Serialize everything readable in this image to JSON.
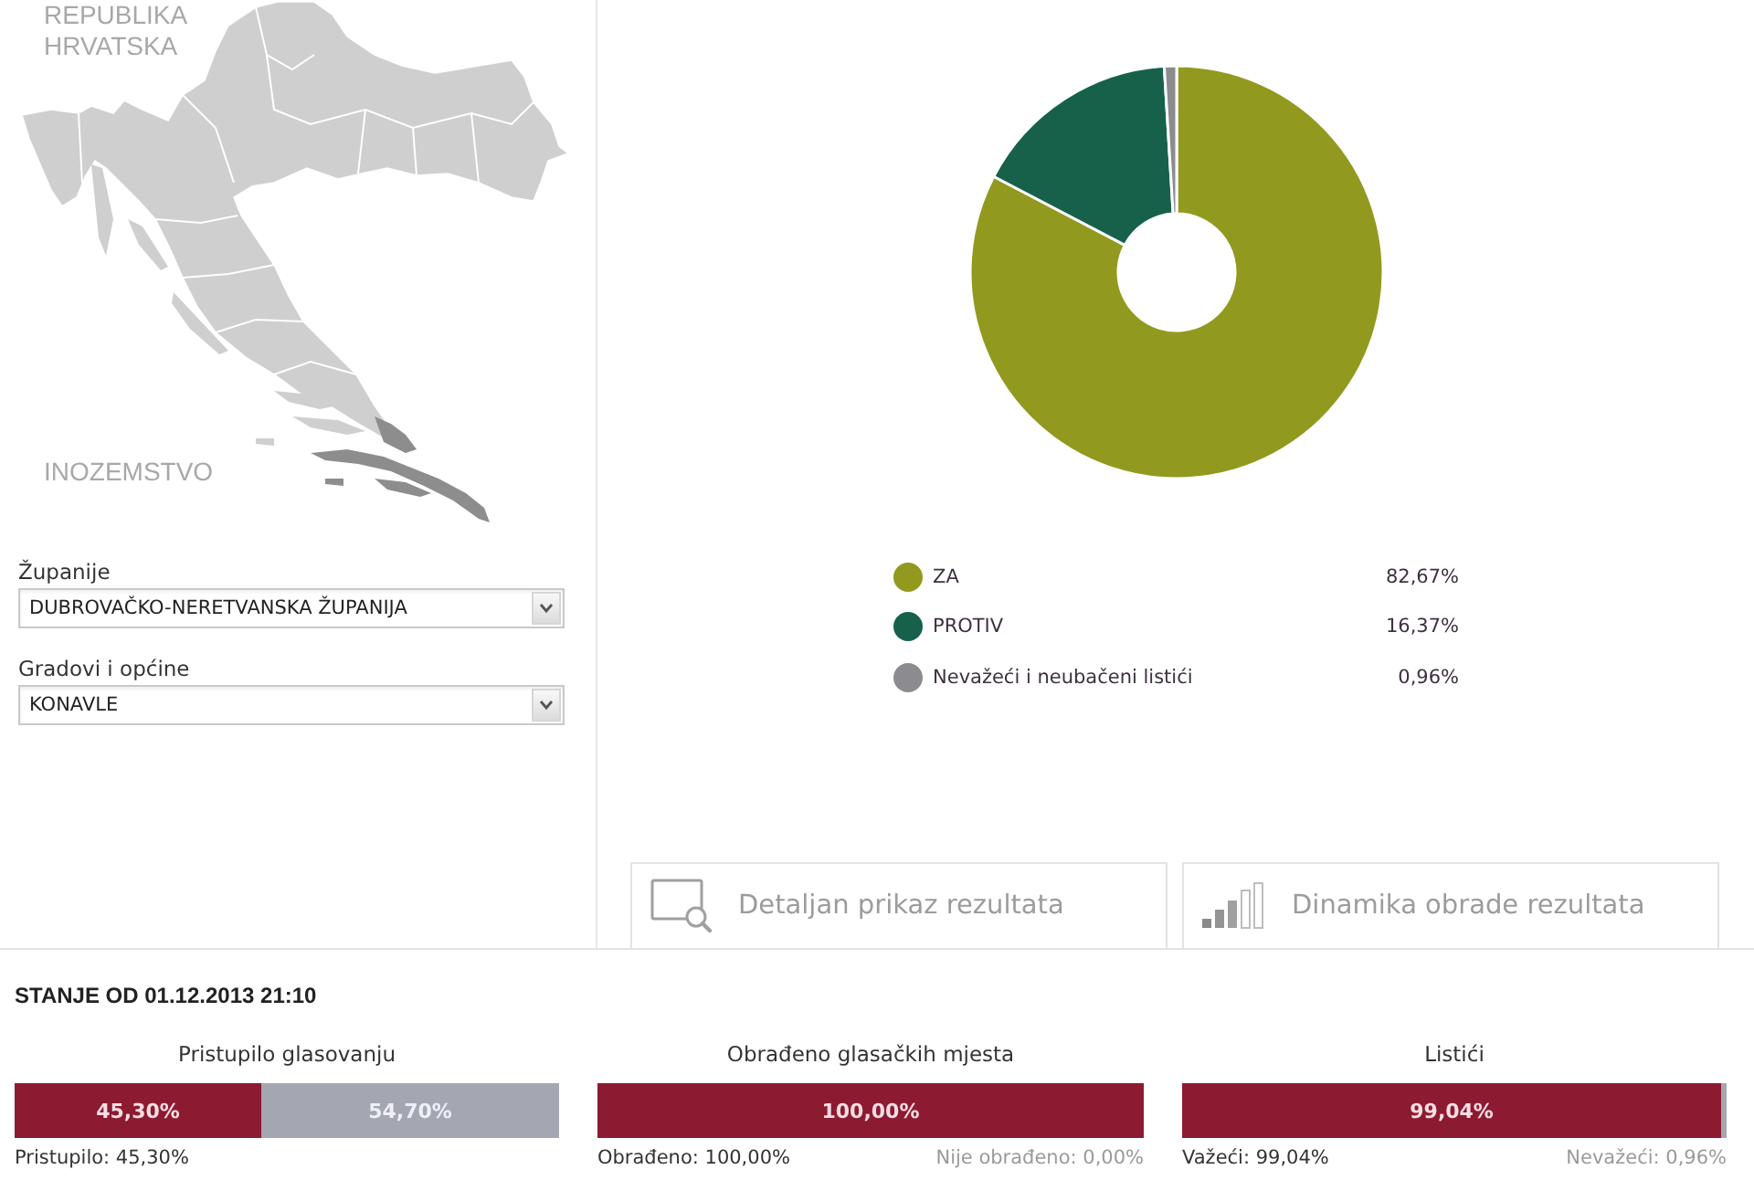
{
  "map": {
    "title": "REPUBLIKA HRVATSKA",
    "abroad_label": "INOZEMSTVO"
  },
  "filters": [
    {
      "label": "Županije",
      "value": "DUBROVAČKO-NERETVANSKA ŽUPANIJA"
    },
    {
      "label": "Gradovi i općine",
      "value": "KONAVLE"
    }
  ],
  "results": {
    "chart_data": {
      "type": "donut",
      "categories": [
        "ZA",
        "PROTIV",
        "Nevažeći i neubačeni listići"
      ],
      "values": [
        82.67,
        16.37,
        0.96
      ]
    },
    "legend": [
      {
        "value": "82,67%",
        "color": "#919a1f"
      },
      {
        "value": "16,37%",
        "color": "#17614b"
      },
      {
        "value": "0,96%",
        "color": "#8c8c90"
      }
    ]
  },
  "buttons": [
    {
      "kind": "detail",
      "label": "Detaljan prikaz rezultata"
    },
    {
      "kind": "progress",
      "label": "Dinamika obrade rezultata"
    }
  ],
  "status": {
    "title": "STANJE OD 01.12.2013 21:10",
    "bars": [
      {
        "title": "Pristupilo glasovanju",
        "level": 0.453,
        "fill_label": "45,30%",
        "rest_label": "54,70%",
        "left_note": "Pristupilo: 45,30%"
      },
      {
        "title": "Obrađeno glasačkih mjesta",
        "level": 1,
        "fill_label": "100,00%",
        "left_note": "Obrađeno: 100,00%",
        "right_note": "Nije obrađeno: 0,00%"
      },
      {
        "title": "Listići",
        "level": 0.9904,
        "fill_label": "99,04%",
        "left_note": "Važeći: 99,04%",
        "right_note": "Nevažeći: 0,96%"
      }
    ]
  }
}
